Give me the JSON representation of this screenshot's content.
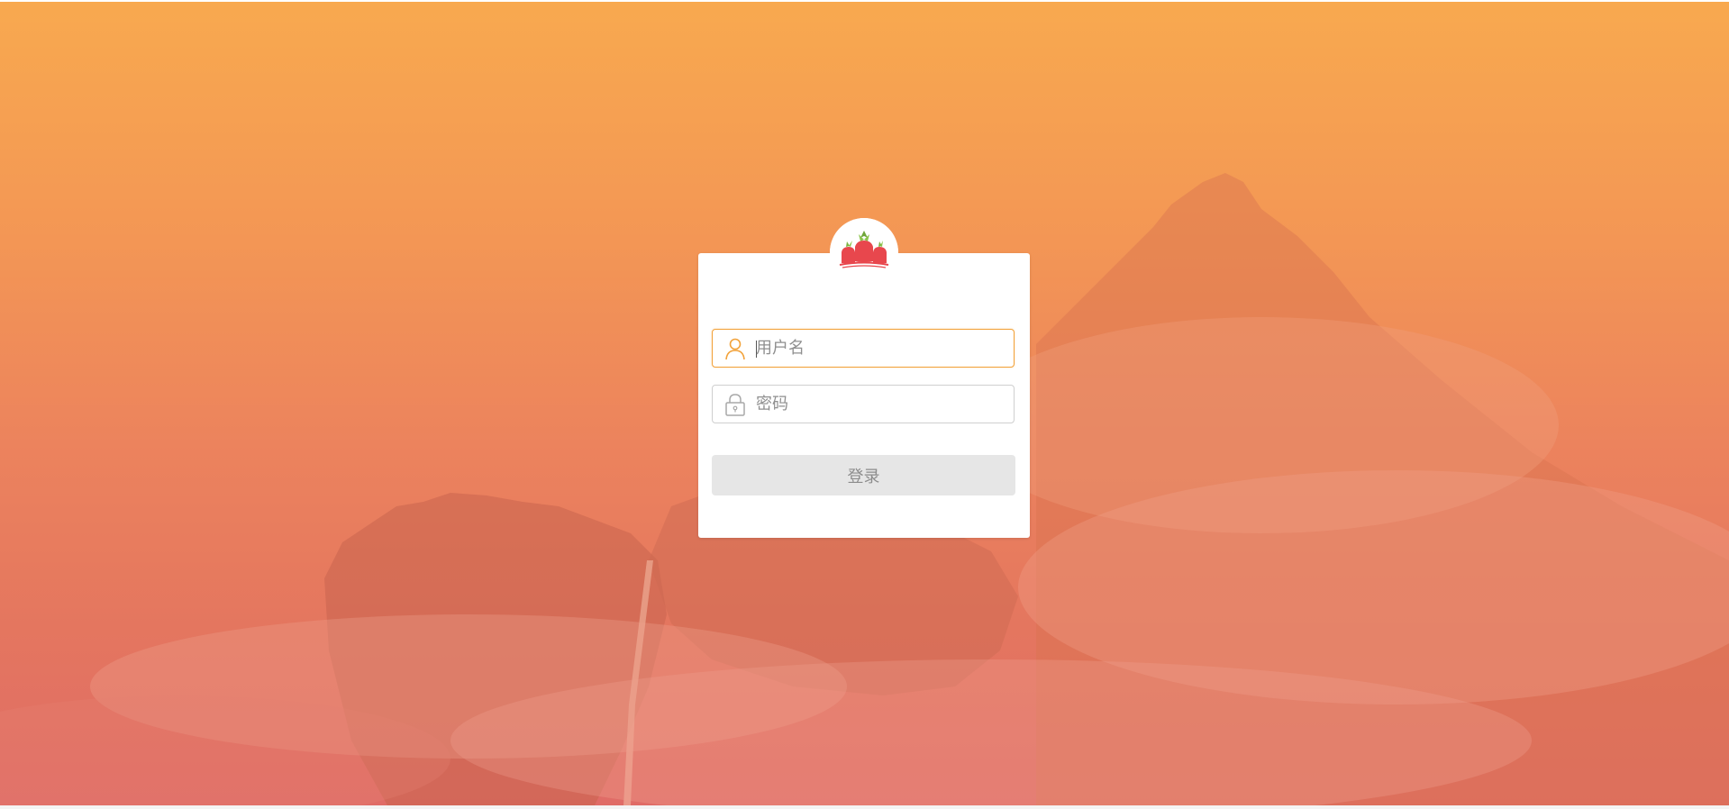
{
  "login": {
    "username_placeholder": "用户名",
    "password_placeholder": "密码",
    "submit_label": "登录"
  },
  "icons": {
    "logo": "radish-logo-icon",
    "username": "user-icon",
    "password": "lock-icon"
  },
  "colors": {
    "accent": "#f2a23a",
    "button_bg": "#e6e6e6",
    "button_text": "#8c8c8c",
    "background_top": "#f8a94f",
    "background_bottom": "#e06c67"
  }
}
